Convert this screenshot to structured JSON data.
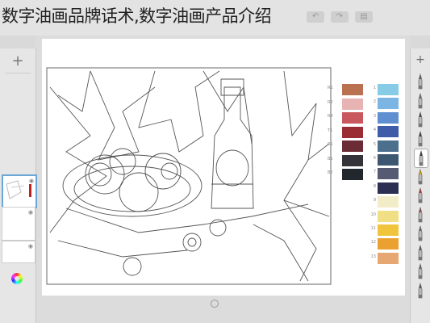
{
  "title": "数字油画品牌话术,数字油画产品介绍",
  "left_panel": {
    "add_label": "+"
  },
  "palette": {
    "left_labels": [
      "R1",
      "R2",
      "R3",
      "T1",
      "R5",
      "B1",
      "B2"
    ],
    "left_colors": [
      "#b9714f",
      "#e7b3b3",
      "#c8585d",
      "#9a2c34",
      "#6b2c35",
      "#35333a",
      "#22262d"
    ],
    "right_labels": [
      "1",
      "2",
      "3",
      "4",
      "5",
      "6",
      "7",
      "8",
      "9",
      "10",
      "11",
      "12",
      "13"
    ],
    "right_colors": [
      "#86cce6",
      "#7bb5e3",
      "#5f8fd0",
      "#3e5ca8",
      "#4d6f8e",
      "#3e5770",
      "#575a73",
      "#2c2f52",
      "#f3ecc8",
      "#f1df85",
      "#f0c53d",
      "#eba131",
      "#e7a773"
    ]
  },
  "tools": [
    "brush-1",
    "brush-2",
    "brush-3",
    "brush-4",
    "brush-5-selected",
    "pencil",
    "brush-7",
    "brush-8",
    "brush-9",
    "brush-10",
    "brush-11",
    "brush-12"
  ]
}
